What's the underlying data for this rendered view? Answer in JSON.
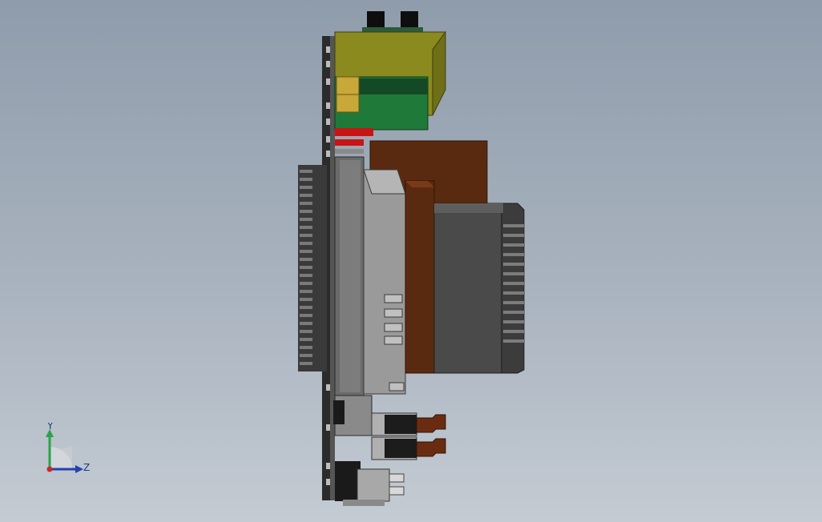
{
  "viewport": {
    "background_top": "#8f9cab",
    "background_bottom": "#c4cbd3"
  },
  "triad": {
    "y_label": "Y",
    "z_label": "Z",
    "y_color": "#2aa24a",
    "z_color": "#2540b0",
    "x_color": "#c82828"
  },
  "model": {
    "board_color": "#2a2a2a",
    "pcb_green": "#1f7a3a",
    "olive_housing": "#8a8a1e",
    "copper_block": "#5a2a10",
    "heatsink_gray": "#4a4a4a",
    "connector_gray": "#8c8c8c",
    "accent_red": "#c81414",
    "capacitor_gold": "#c8a838"
  }
}
